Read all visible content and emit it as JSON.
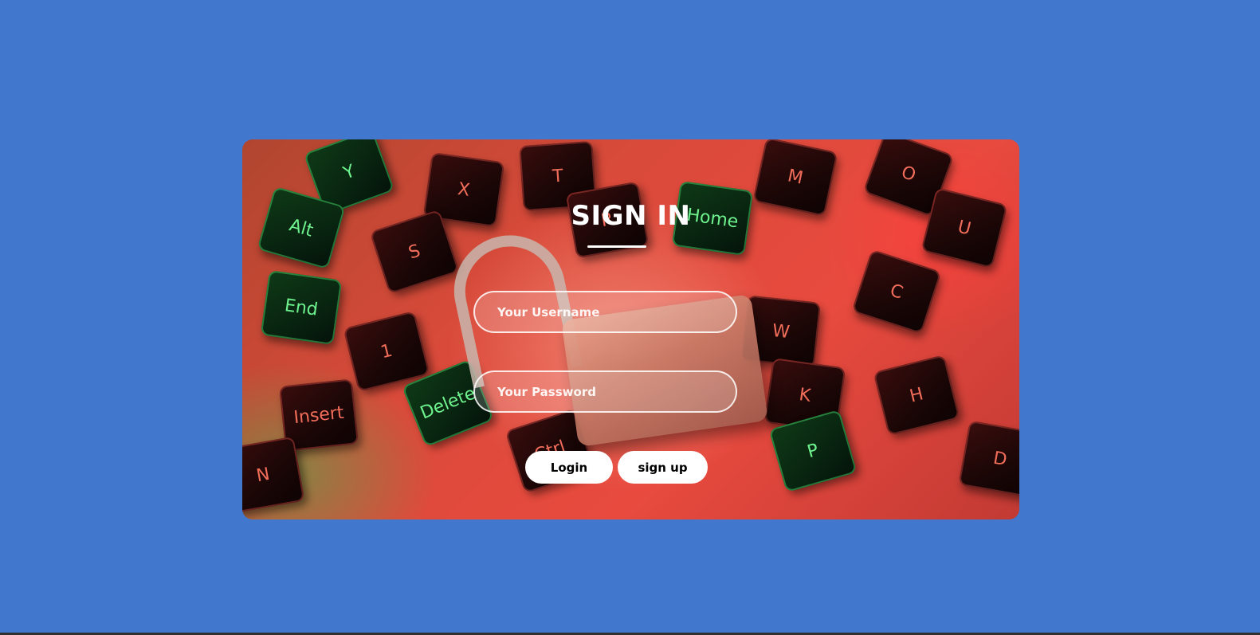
{
  "app": {
    "background_color": "#4177cc"
  },
  "card": {
    "background_image": "keyboard-keys-and-padlock-image",
    "keycaps": [
      "Y",
      "X",
      "T",
      "M",
      "O",
      "Alt",
      "S",
      "R",
      "Home",
      "End",
      "1",
      "End",
      "Delete",
      "Insert",
      "Ctrl",
      "N",
      "W",
      "C",
      "U",
      "K",
      "P",
      "H",
      "D"
    ]
  },
  "form": {
    "title": "SIGN IN",
    "username": {
      "placeholder": "Your Username",
      "value": ""
    },
    "password": {
      "placeholder": "Your Password",
      "value": ""
    },
    "buttons": {
      "login_label": "Login",
      "signup_label": "sign up"
    },
    "colors": {
      "title": "#ffffff",
      "button_bg": "#ffffff",
      "button_text": "#000000"
    }
  }
}
